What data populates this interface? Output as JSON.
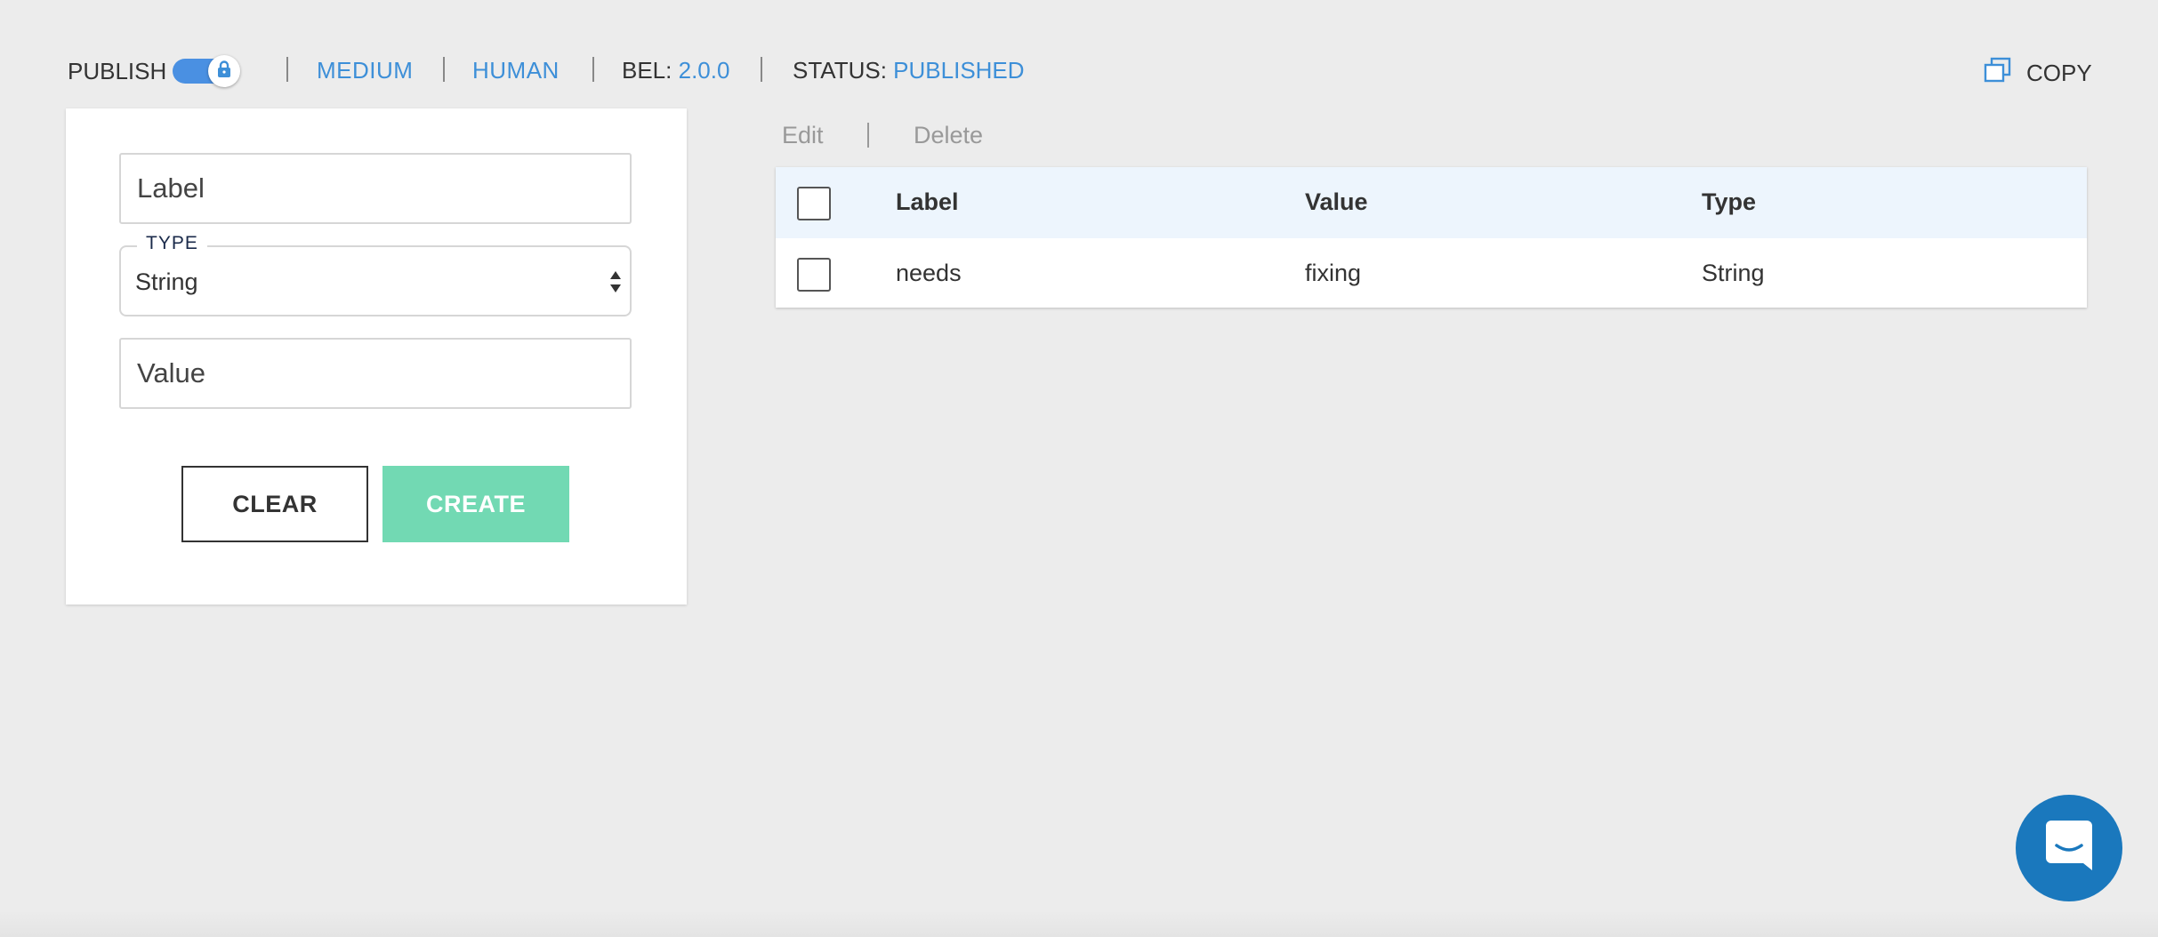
{
  "topbar": {
    "publish_label": "PUBLISH",
    "publish_toggle_on": true,
    "links": {
      "medium": "MEDIUM",
      "human": "HUMAN"
    },
    "bel_label": "BEL:",
    "bel_version": "2.0.0",
    "status_label": "STATUS:",
    "status_value": "PUBLISHED",
    "copy_label": "COPY",
    "accent_color": "#3d8fd8"
  },
  "form": {
    "label_placeholder": "Label",
    "type_legend": "TYPE",
    "type_value": "String",
    "value_placeholder": "Value",
    "clear_label": "CLEAR",
    "create_label": "CREATE",
    "create_color": "#72d9b3"
  },
  "actions": {
    "edit": "Edit",
    "delete": "Delete"
  },
  "table": {
    "columns": [
      "Label",
      "Value",
      "Type"
    ],
    "rows": [
      {
        "label": "needs",
        "value": "fixing",
        "type": "String"
      }
    ]
  },
  "icons": {
    "toggle_knob": "lock-icon",
    "copy": "copy-icon",
    "chat": "chat-icon"
  }
}
